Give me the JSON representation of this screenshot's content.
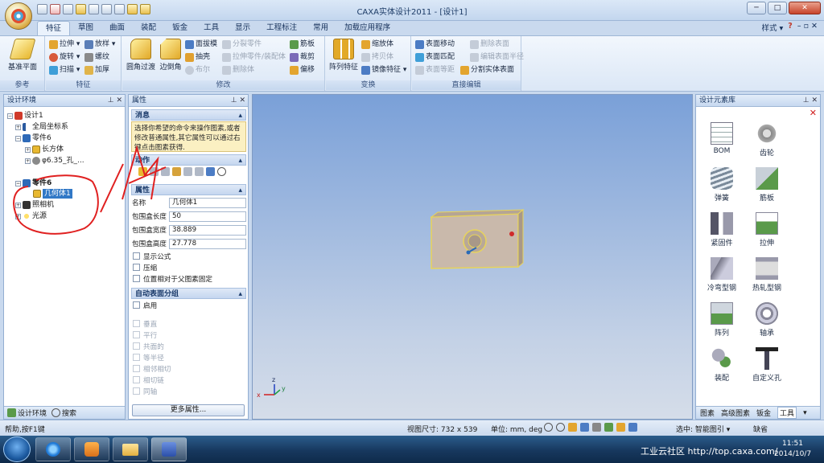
{
  "window": {
    "title": "CAXA实体设计2011 - [设计1]",
    "controls": {
      "minimize": "─",
      "maximize": "□",
      "close": "✕"
    }
  },
  "ribbon": {
    "tabs": [
      "特征",
      "草图",
      "曲面",
      "装配",
      "钣金",
      "工具",
      "显示",
      "工程标注",
      "常用",
      "加载应用程序"
    ],
    "active_tab": "特征",
    "right": {
      "style": "样式 ▾",
      "help": "?",
      "controls": "– ▫ ✕"
    },
    "groups": {
      "reference": {
        "label": "参考",
        "base_plane": "基准平面"
      },
      "feature": {
        "label": "特征",
        "items": [
          "拉伸 ▾",
          "放样 ▾",
          "旋转 ▾",
          "螺纹",
          "扫描 ▾",
          "加厚"
        ]
      },
      "modify": {
        "label": "修改",
        "big": [
          "圆角过渡",
          "边倒角"
        ],
        "items": [
          "面拔模",
          "分裂零件",
          "抽壳",
          "拉伸零件/装配体",
          "布尔",
          "删除体"
        ],
        "items2": [
          "筋板",
          "裁剪",
          "偏移"
        ]
      },
      "transform": {
        "label": "变换",
        "big": "阵列特征",
        "items": [
          "缩放体",
          "拷贝体",
          "镜像特征 ▾"
        ]
      },
      "direct_edit": {
        "label": "直接编辑",
        "items": [
          "表面移动",
          "删除表面",
          "表面匹配",
          "编辑表面半径",
          "表面等距",
          "分割实体表面"
        ]
      }
    }
  },
  "design_env": {
    "title": "设计环境",
    "tree": [
      {
        "label": "设计1"
      },
      {
        "label": "全局坐标系"
      },
      {
        "label": "零件6"
      },
      {
        "label": "长方体"
      },
      {
        "label": "φ6.35_孔_..."
      },
      {
        "label": "零件6"
      },
      {
        "label": "几何体1"
      },
      {
        "label": "照相机"
      },
      {
        "label": "光源"
      }
    ],
    "footer_tabs": [
      "设计环境",
      "搜索"
    ]
  },
  "properties": {
    "title": "属性",
    "message": {
      "header": "消息",
      "text": "选择你希望的命令来操作图素,或者修改普通属性,其它属性可以通过右键点击图素获得."
    },
    "actions": {
      "header": "动作"
    },
    "attributes": {
      "header": "属性",
      "rows": [
        {
          "label": "名称",
          "value": "几何体1"
        },
        {
          "label": "包围盒长度",
          "value": "50"
        },
        {
          "label": "包围盒宽度",
          "value": "38.889"
        },
        {
          "label": "包围盒高度",
          "value": "27.778"
        }
      ],
      "checks": [
        "显示公式",
        "压缩",
        "位置相对于父图素固定"
      ]
    },
    "auto_group": {
      "header": "自动表面分组",
      "enable": "启用",
      "options": [
        "垂直",
        "平行",
        "共面的",
        "等半径",
        "相邻相切",
        "相切链",
        "同轴"
      ]
    },
    "more_button": "更多属性..."
  },
  "viewport": {
    "axes": {
      "x": "x",
      "y": "y",
      "z": "z"
    }
  },
  "library": {
    "title": "设计元素库",
    "items": [
      "BOM",
      "齿轮",
      "弹簧",
      "筋板",
      "紧固件",
      "拉伸",
      "冷弯型钢",
      "热轧型钢",
      "阵列",
      "轴承",
      "装配",
      "自定义孔"
    ],
    "tabs": [
      "图素",
      "高级图素",
      "钣金",
      "工具"
    ]
  },
  "status": {
    "help": "帮助,按F1键",
    "view_size": "视图尺寸: 732 x 539",
    "units": "单位: mm, deg",
    "select_mode": "选中: 智能图引 ▾",
    "default": "缺省"
  },
  "taskbar": {
    "watermark": "工业云社区 http://top.caxa.com/",
    "time": "11:51",
    "date": "2014/10/7"
  },
  "colors": {
    "accent": "#3178c6",
    "viewport_top": "#7aa0d8",
    "part_face": "#c9b9ab",
    "highlight": "#e8d45a"
  }
}
